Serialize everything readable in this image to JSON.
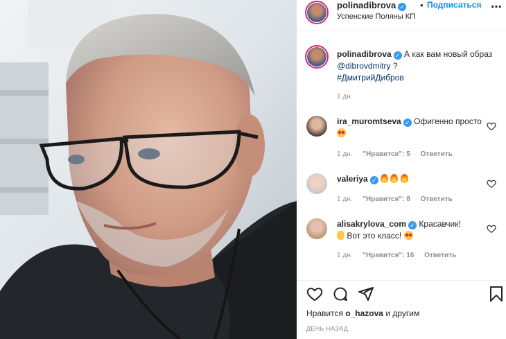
{
  "post": {
    "author": "polinadibrova",
    "follow_label": "Подписаться",
    "separator": "•",
    "location": "Успенские Поляны КП",
    "more_icon": "more-horizontal-icon",
    "verified_icon": "verified-badge-icon"
  },
  "caption": {
    "username": "polinadibrova",
    "text_before": "А как вам новый образ",
    "mention": "@dibrovdmitry",
    "text_after": " ?",
    "hashtag": "#ДмитрийДибров",
    "time": "1 дн."
  },
  "comments": [
    {
      "username": "ira_muromtseva",
      "verified": true,
      "text": "Офигенно просто",
      "emoji": "star-struck-emoji",
      "time": "1 дн.",
      "likes": "\"Нравится\": 5",
      "reply": "Ответить"
    },
    {
      "username": "valeriya",
      "verified": true,
      "text": "",
      "emoji": "fire-emoji x3",
      "time": "1 дн.",
      "likes": "\"Нравится\": 8",
      "reply": "Ответить"
    },
    {
      "username": "alisakrylova_com",
      "verified": true,
      "text_line1": "Красавчик!",
      "text_line2": "Вот это класс!",
      "emoji": "ok-hand-emoji, star-struck-emoji",
      "time": "1 дн.",
      "likes": "\"Нравится\": 16",
      "reply": "Ответить"
    }
  ],
  "actions": {
    "like_icon": "heart-icon",
    "comment_icon": "comment-icon",
    "share_icon": "share-icon",
    "save_icon": "bookmark-icon"
  },
  "likes": {
    "prefix": "Нравится",
    "user": "o_hazova",
    "suffix": "и другим"
  },
  "date": "ДЕНЬ НАЗАД",
  "colors": {
    "follow": "#0095f6",
    "verified": "#3897f0",
    "link": "#00376b",
    "meta": "#8e8e8e",
    "story_ring": "#d62976"
  }
}
